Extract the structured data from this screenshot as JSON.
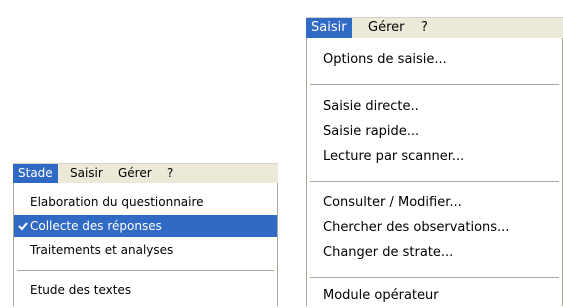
{
  "left_menu": {
    "menubar": {
      "items": [
        {
          "label": "Stade",
          "active": true
        },
        {
          "label": "Saisir",
          "active": false
        },
        {
          "label": "Gérer",
          "active": false
        },
        {
          "label": "?",
          "active": false
        }
      ]
    },
    "dropdown": {
      "items": [
        {
          "label": "Elaboration du questionnaire",
          "checked": false,
          "highlighted": false
        },
        {
          "label": "Collecte des réponses",
          "checked": true,
          "highlighted": true
        },
        {
          "label": "Traitements et analyses",
          "checked": false,
          "highlighted": false
        },
        {
          "label": "Etude des textes",
          "checked": false,
          "highlighted": false
        }
      ]
    }
  },
  "right_menu": {
    "menubar": {
      "items": [
        {
          "label": "Saisir",
          "active": true
        },
        {
          "label": "Gérer",
          "active": false
        },
        {
          "label": "?",
          "active": false
        }
      ]
    },
    "dropdown": {
      "items": [
        {
          "label": "Options de saisie..."
        },
        {
          "label": "Saisie directe.."
        },
        {
          "label": "Saisie rapide..."
        },
        {
          "label": "Lecture par scanner..."
        },
        {
          "label": "Consulter / Modifier..."
        },
        {
          "label": "Chercher des observations..."
        },
        {
          "label": "Changer de strate..."
        },
        {
          "label": "Module opérateur"
        }
      ]
    }
  },
  "colors": {
    "highlight": "#316ac5",
    "menubar_bg": "#ece9d8",
    "separator": "#aca899"
  },
  "icons": {
    "check": "check-icon"
  }
}
